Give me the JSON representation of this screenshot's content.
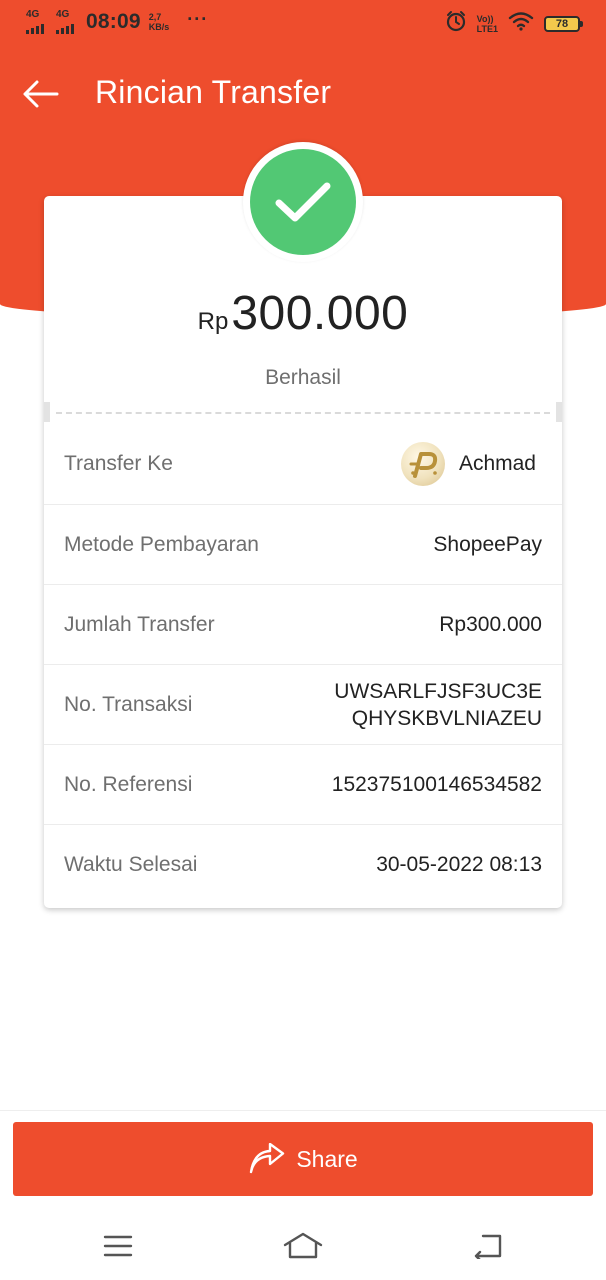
{
  "status_bar": {
    "sim1_label": "4G",
    "sim2_label": "4G",
    "time": "08:09",
    "speed_value": "2,7",
    "speed_unit": "KB/s",
    "more_indicator": "···",
    "volte_top": "Vo))",
    "volte_bottom": "LTE1",
    "battery_level": "78",
    "icons": [
      "signal-icon",
      "signal-icon",
      "alarm-icon",
      "wifi-icon",
      "battery-icon"
    ]
  },
  "header": {
    "title": "Rincian Transfer",
    "back_icon": "arrow-left-icon"
  },
  "receipt": {
    "status_icon": "check-icon",
    "currency": "Rp",
    "amount": "300.000",
    "status": "Berhasil",
    "rows": [
      {
        "label": "Transfer Ke",
        "value": "Achmad",
        "avatar_icon": "recipient-avatar-icon"
      },
      {
        "label": "Metode Pembayaran",
        "value": "ShopeePay"
      },
      {
        "label": "Jumlah Transfer",
        "value": "Rp300.000"
      },
      {
        "label": "No. Transaksi",
        "value_line1": "UWSARLFJSF3UC3E",
        "value_line2": "QHYSKBVLNIAZEU"
      },
      {
        "label": "No. Referensi",
        "value": "152375100146534582"
      },
      {
        "label": "Waktu Selesai",
        "value": "30-05-2022 08:13"
      }
    ]
  },
  "share": {
    "label": "Share",
    "icon": "share-icon"
  },
  "nav": {
    "menu_icon": "menu-icon",
    "home_icon": "home-icon",
    "back_icon": "nav-back-icon"
  },
  "colors": {
    "brand": "#ee4d2d",
    "success": "#52c874",
    "label_text": "#6f6f6f",
    "value_text": "#222222"
  }
}
